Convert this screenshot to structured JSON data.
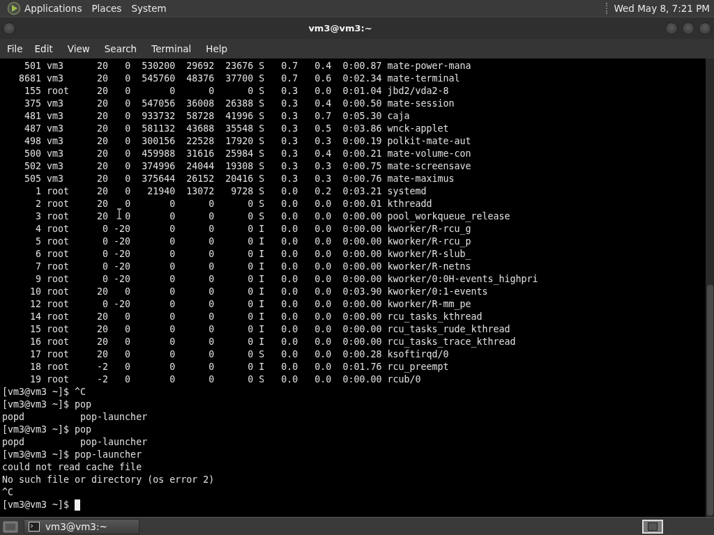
{
  "top_panel": {
    "menus": [
      "Applications",
      "Places",
      "System"
    ],
    "clock": "Wed May 8, 7:21 PM"
  },
  "window": {
    "title": "vm3@vm3:~"
  },
  "menubar": [
    "File",
    "Edit",
    "View",
    "Search",
    "Terminal",
    "Help"
  ],
  "terminal": {
    "processes": [
      {
        "pid": "501",
        "user": "vm3",
        "pr": "20",
        "ni": "0",
        "virt": "530200",
        "res": "29692",
        "shr": "23676",
        "s": "S",
        "cpu": "0.7",
        "mem": "0.4",
        "time": "0:00.87",
        "command": "mate-power-mana"
      },
      {
        "pid": "8681",
        "user": "vm3",
        "pr": "20",
        "ni": "0",
        "virt": "545760",
        "res": "48376",
        "shr": "37700",
        "s": "S",
        "cpu": "0.7",
        "mem": "0.6",
        "time": "0:02.34",
        "command": "mate-terminal"
      },
      {
        "pid": "155",
        "user": "root",
        "pr": "20",
        "ni": "0",
        "virt": "0",
        "res": "0",
        "shr": "0",
        "s": "S",
        "cpu": "0.3",
        "mem": "0.0",
        "time": "0:01.04",
        "command": "jbd2/vda2-8"
      },
      {
        "pid": "375",
        "user": "vm3",
        "pr": "20",
        "ni": "0",
        "virt": "547056",
        "res": "36008",
        "shr": "26388",
        "s": "S",
        "cpu": "0.3",
        "mem": "0.4",
        "time": "0:00.50",
        "command": "mate-session"
      },
      {
        "pid": "481",
        "user": "vm3",
        "pr": "20",
        "ni": "0",
        "virt": "933732",
        "res": "58728",
        "shr": "41996",
        "s": "S",
        "cpu": "0.3",
        "mem": "0.7",
        "time": "0:05.30",
        "command": "caja"
      },
      {
        "pid": "487",
        "user": "vm3",
        "pr": "20",
        "ni": "0",
        "virt": "581132",
        "res": "43688",
        "shr": "35548",
        "s": "S",
        "cpu": "0.3",
        "mem": "0.5",
        "time": "0:03.86",
        "command": "wnck-applet"
      },
      {
        "pid": "498",
        "user": "vm3",
        "pr": "20",
        "ni": "0",
        "virt": "300156",
        "res": "22528",
        "shr": "17920",
        "s": "S",
        "cpu": "0.3",
        "mem": "0.3",
        "time": "0:00.19",
        "command": "polkit-mate-aut"
      },
      {
        "pid": "500",
        "user": "vm3",
        "pr": "20",
        "ni": "0",
        "virt": "459988",
        "res": "31616",
        "shr": "25984",
        "s": "S",
        "cpu": "0.3",
        "mem": "0.4",
        "time": "0:00.21",
        "command": "mate-volume-con"
      },
      {
        "pid": "502",
        "user": "vm3",
        "pr": "20",
        "ni": "0",
        "virt": "374996",
        "res": "24044",
        "shr": "19308",
        "s": "S",
        "cpu": "0.3",
        "mem": "0.3",
        "time": "0:00.75",
        "command": "mate-screensave"
      },
      {
        "pid": "505",
        "user": "vm3",
        "pr": "20",
        "ni": "0",
        "virt": "375644",
        "res": "26152",
        "shr": "20416",
        "s": "S",
        "cpu": "0.3",
        "mem": "0.3",
        "time": "0:00.76",
        "command": "mate-maximus"
      },
      {
        "pid": "1",
        "user": "root",
        "pr": "20",
        "ni": "0",
        "virt": "21940",
        "res": "13072",
        "shr": "9728",
        "s": "S",
        "cpu": "0.0",
        "mem": "0.2",
        "time": "0:03.21",
        "command": "systemd"
      },
      {
        "pid": "2",
        "user": "root",
        "pr": "20",
        "ni": "0",
        "virt": "0",
        "res": "0",
        "shr": "0",
        "s": "S",
        "cpu": "0.0",
        "mem": "0.0",
        "time": "0:00.01",
        "command": "kthreadd"
      },
      {
        "pid": "3",
        "user": "root",
        "pr": "20",
        "ni": "0",
        "virt": "0",
        "res": "0",
        "shr": "0",
        "s": "S",
        "cpu": "0.0",
        "mem": "0.0",
        "time": "0:00.00",
        "command": "pool_workqueue_release"
      },
      {
        "pid": "4",
        "user": "root",
        "pr": "0",
        "ni": "-20",
        "virt": "0",
        "res": "0",
        "shr": "0",
        "s": "I",
        "cpu": "0.0",
        "mem": "0.0",
        "time": "0:00.00",
        "command": "kworker/R-rcu_g"
      },
      {
        "pid": "5",
        "user": "root",
        "pr": "0",
        "ni": "-20",
        "virt": "0",
        "res": "0",
        "shr": "0",
        "s": "I",
        "cpu": "0.0",
        "mem": "0.0",
        "time": "0:00.00",
        "command": "kworker/R-rcu_p"
      },
      {
        "pid": "6",
        "user": "root",
        "pr": "0",
        "ni": "-20",
        "virt": "0",
        "res": "0",
        "shr": "0",
        "s": "I",
        "cpu": "0.0",
        "mem": "0.0",
        "time": "0:00.00",
        "command": "kworker/R-slub_"
      },
      {
        "pid": "7",
        "user": "root",
        "pr": "0",
        "ni": "-20",
        "virt": "0",
        "res": "0",
        "shr": "0",
        "s": "I",
        "cpu": "0.0",
        "mem": "0.0",
        "time": "0:00.00",
        "command": "kworker/R-netns"
      },
      {
        "pid": "9",
        "user": "root",
        "pr": "0",
        "ni": "-20",
        "virt": "0",
        "res": "0",
        "shr": "0",
        "s": "I",
        "cpu": "0.0",
        "mem": "0.0",
        "time": "0:00.00",
        "command": "kworker/0:0H-events_highpri"
      },
      {
        "pid": "10",
        "user": "root",
        "pr": "20",
        "ni": "0",
        "virt": "0",
        "res": "0",
        "shr": "0",
        "s": "I",
        "cpu": "0.0",
        "mem": "0.0",
        "time": "0:03.90",
        "command": "kworker/0:1-events"
      },
      {
        "pid": "12",
        "user": "root",
        "pr": "0",
        "ni": "-20",
        "virt": "0",
        "res": "0",
        "shr": "0",
        "s": "I",
        "cpu": "0.0",
        "mem": "0.0",
        "time": "0:00.00",
        "command": "kworker/R-mm_pe"
      },
      {
        "pid": "14",
        "user": "root",
        "pr": "20",
        "ni": "0",
        "virt": "0",
        "res": "0",
        "shr": "0",
        "s": "I",
        "cpu": "0.0",
        "mem": "0.0",
        "time": "0:00.00",
        "command": "rcu_tasks_kthread"
      },
      {
        "pid": "15",
        "user": "root",
        "pr": "20",
        "ni": "0",
        "virt": "0",
        "res": "0",
        "shr": "0",
        "s": "I",
        "cpu": "0.0",
        "mem": "0.0",
        "time": "0:00.00",
        "command": "rcu_tasks_rude_kthread"
      },
      {
        "pid": "16",
        "user": "root",
        "pr": "20",
        "ni": "0",
        "virt": "0",
        "res": "0",
        "shr": "0",
        "s": "I",
        "cpu": "0.0",
        "mem": "0.0",
        "time": "0:00.00",
        "command": "rcu_tasks_trace_kthread"
      },
      {
        "pid": "17",
        "user": "root",
        "pr": "20",
        "ni": "0",
        "virt": "0",
        "res": "0",
        "shr": "0",
        "s": "S",
        "cpu": "0.0",
        "mem": "0.0",
        "time": "0:00.28",
        "command": "ksoftirqd/0"
      },
      {
        "pid": "18",
        "user": "root",
        "pr": "-2",
        "ni": "0",
        "virt": "0",
        "res": "0",
        "shr": "0",
        "s": "I",
        "cpu": "0.0",
        "mem": "0.0",
        "time": "0:01.76",
        "command": "rcu_preempt"
      },
      {
        "pid": "19",
        "user": "root",
        "pr": "-2",
        "ni": "0",
        "virt": "0",
        "res": "0",
        "shr": "0",
        "s": "S",
        "cpu": "0.0",
        "mem": "0.0",
        "time": "0:00.00",
        "command": "rcub/0"
      }
    ],
    "lines": [
      "[vm3@vm3 ~]$ ^C",
      "[vm3@vm3 ~]$ pop",
      "popd          pop-launcher",
      "[vm3@vm3 ~]$ pop",
      "popd          pop-launcher",
      "[vm3@vm3 ~]$ pop-launcher",
      "could not read cache file",
      "No such file or directory (os error 2)",
      "^C"
    ],
    "prompt": "[vm3@vm3 ~]$"
  },
  "taskbar": {
    "tasks": [
      {
        "label": "vm3@vm3:~",
        "selected": false
      }
    ]
  }
}
